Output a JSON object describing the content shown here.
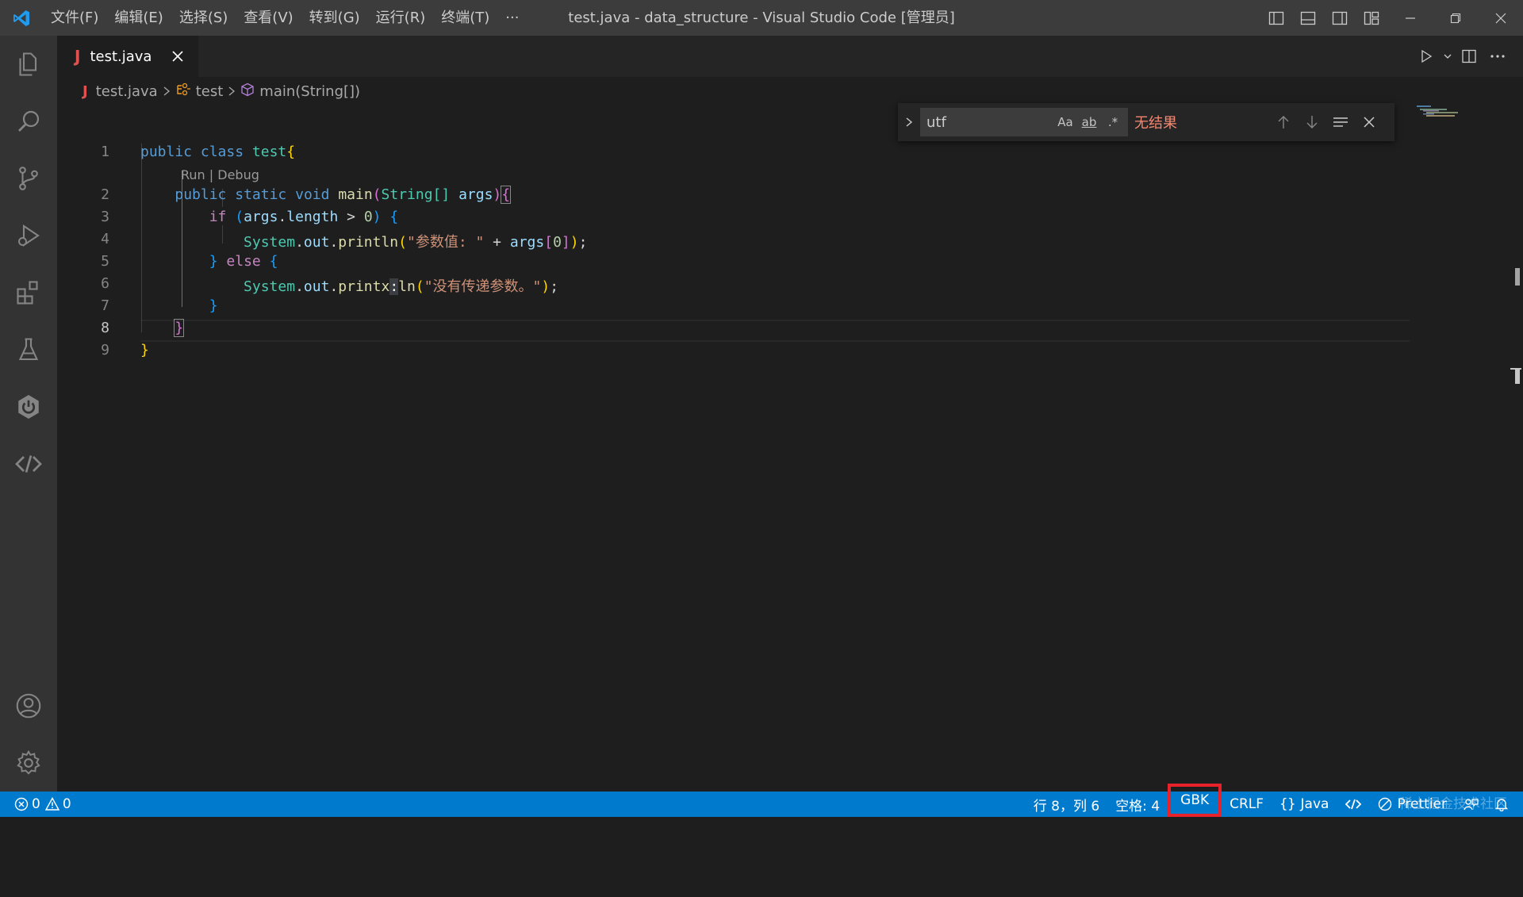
{
  "titlebar": {
    "menu": [
      "文件(F)",
      "编辑(E)",
      "选择(S)",
      "查看(V)",
      "转到(G)",
      "运行(R)",
      "终端(T)",
      "···"
    ],
    "window_title": "test.java - data_structure - Visual Studio Code [管理员]"
  },
  "tab": {
    "icon": "J",
    "label": "test.java"
  },
  "breadcrumb": {
    "file": "test.java",
    "class": "test",
    "method": "main(String[])"
  },
  "editor": {
    "line_numbers": [
      "1",
      "2",
      "3",
      "4",
      "5",
      "6",
      "7",
      "8",
      "9"
    ],
    "current_line": "8",
    "codelens": "Run | Debug",
    "lines": {
      "l1": {
        "kw1": "public",
        "kw2": "class",
        "name": "test",
        "brace": "{"
      },
      "l2": {
        "kw1": "public",
        "kw2": "static",
        "kw3": "void",
        "fn": "main",
        "p1": "(",
        "type": "String[]",
        "arg": "args",
        "p2": ")",
        "brace": "{"
      },
      "l3": {
        "kw": "if",
        "p1": "(",
        "var": "args",
        "dot": ".",
        "prop": "length",
        "op": " > ",
        "num": "0",
        "p2": ")",
        "brace": "{"
      },
      "l4": {
        "cls": "System",
        "d1": ".",
        "out": "out",
        "d2": ".",
        "fn": "println",
        "p1": "(",
        "str": "\"参数值: \"",
        "op": " + ",
        "var": "args",
        "b1": "[",
        "num": "0",
        "b2": "]",
        "p2": ")",
        "semi": ";"
      },
      "l5": {
        "brace1": "}",
        "kw": "else",
        "brace2": "{"
      },
      "l6": {
        "cls": "System",
        "d1": ".",
        "out": "out",
        "d2": ".",
        "fn1": "printx",
        "mid": ":",
        "fn2": "ln",
        "p1": "(",
        "str": "\"没有传递参数。\"",
        "p2": ")",
        "semi": ";"
      },
      "l7": {
        "brace": "}"
      },
      "l8": {
        "brace": "}"
      },
      "l9": {
        "brace": "}"
      }
    }
  },
  "find": {
    "query": "utf",
    "opt_case": "Aa",
    "opt_word": "ab",
    "opt_regex": ".*",
    "result": "无结果"
  },
  "statusbar": {
    "errors": "0",
    "warnings": "0",
    "position": "行 8，列 6",
    "spaces": "空格: 4",
    "encoding": "GBK",
    "eol": "CRLF",
    "language": "Java",
    "prettier": "Prettier",
    "watermark": "稀土掘金技术社区"
  },
  "colors": {
    "statusbar": "#007acc",
    "highlight_box": "#e8212b",
    "find_no_result": "#f48771"
  }
}
